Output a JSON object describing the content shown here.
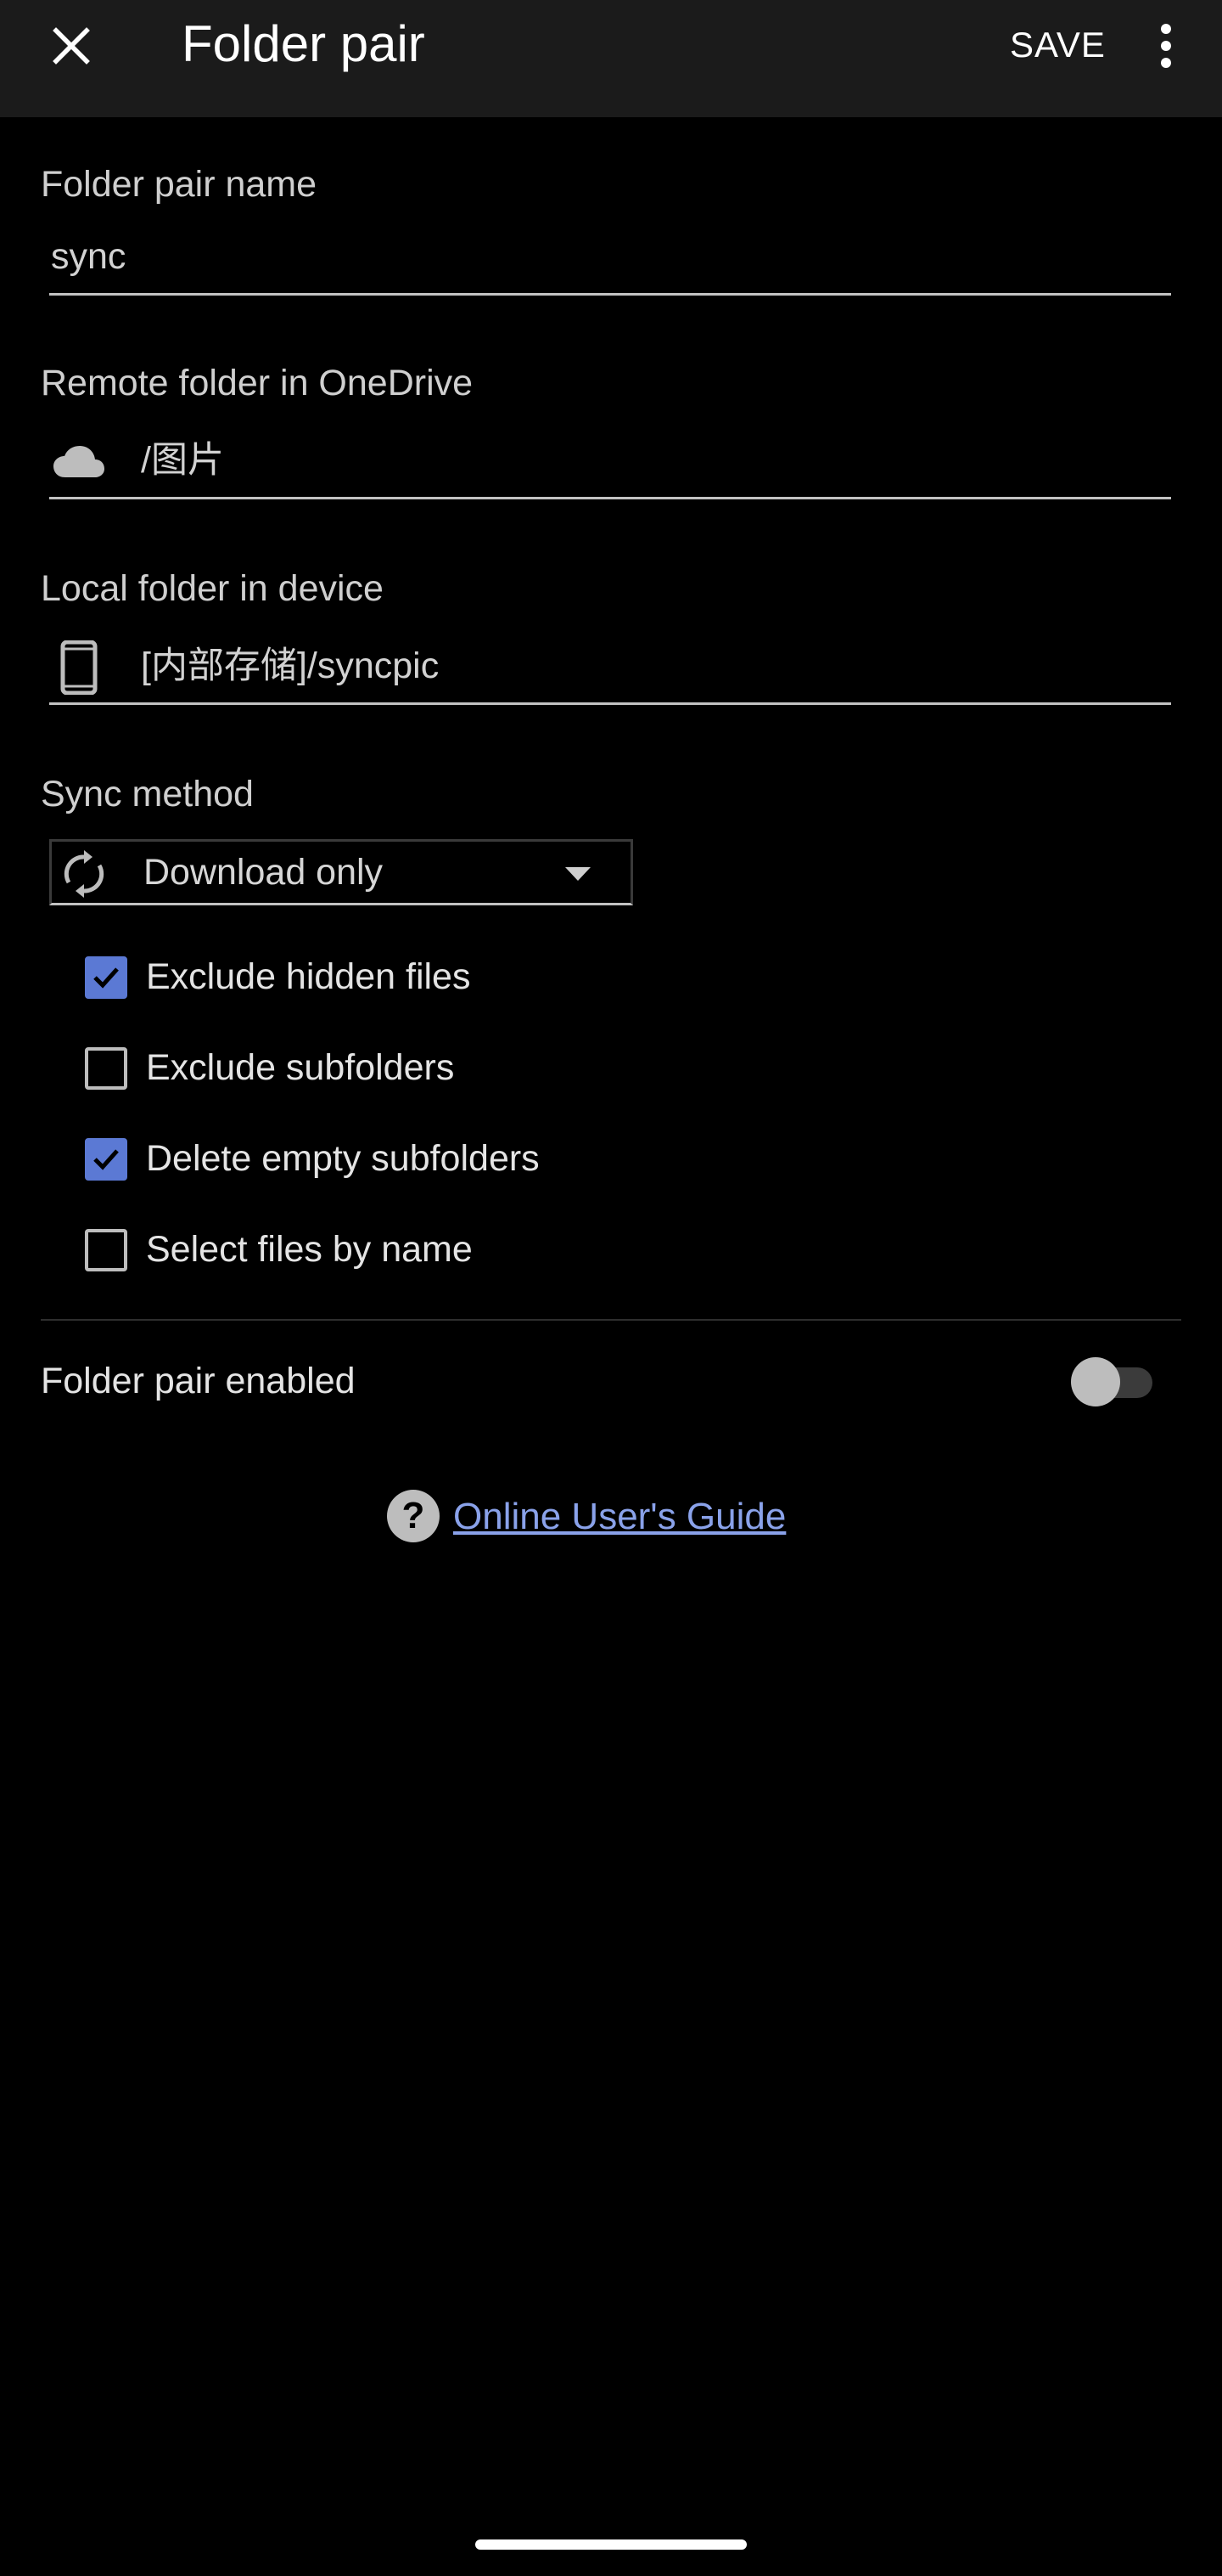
{
  "appbar": {
    "title": "Folder pair",
    "save_label": "SAVE",
    "close_icon": "close-icon",
    "more_icon": "more-vert-icon"
  },
  "folder_pair_name": {
    "label": "Folder pair name",
    "value": "sync"
  },
  "remote_folder": {
    "label": "Remote folder in OneDrive",
    "icon": "cloud-icon",
    "value": "/图片"
  },
  "local_folder": {
    "label": "Local folder in device",
    "icon": "phone-icon",
    "value": "[内部存储]/syncpic"
  },
  "sync_method": {
    "label": "Sync method",
    "icon": "sync-icon",
    "selected": "Download only"
  },
  "options": [
    {
      "label": "Exclude hidden files",
      "checked": true
    },
    {
      "label": "Exclude subfolders",
      "checked": false
    },
    {
      "label": "Delete empty subfolders",
      "checked": true
    },
    {
      "label": "Select files by name",
      "checked": false
    }
  ],
  "enabled": {
    "label": "Folder pair enabled",
    "on": false
  },
  "guide": {
    "icon": "help-icon",
    "link_text": "Online User's Guide"
  },
  "colors": {
    "accent": "#5b79d4",
    "link": "#8aa2ea",
    "appbar_bg": "#1b1b1b",
    "background": "#000000"
  }
}
